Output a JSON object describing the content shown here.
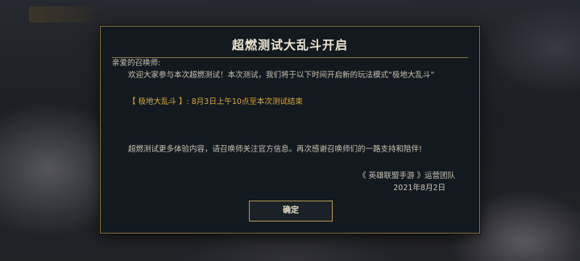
{
  "background": {
    "badge_text": ""
  },
  "dialog": {
    "title": "超燃测试大乱斗开启",
    "greeting": "亲爱的召唤师:",
    "paragraph1": "欢迎大家参与本次超燃测试！本次测试，我们将于以下时间开启新的玩法模式“极地大乱斗”",
    "highlight": "【 极地大乱斗 】: 8月3日上午10点至本次测试结束",
    "paragraph2": "超燃测试更多体验内容，请召唤师关注官方信息。再次感谢召唤师们的一路支持和陪伴!",
    "signature_team": "《 英雄联盟手游 》运营团队",
    "signature_date": "2021年8月2日",
    "confirm_label": "确定"
  },
  "colors": {
    "dialog_bg": "#121a20",
    "border_gold": "#8a7340",
    "title_text": "#eee6d2",
    "body_text": "#c9c3b2",
    "highlight": "#e0a82e"
  }
}
